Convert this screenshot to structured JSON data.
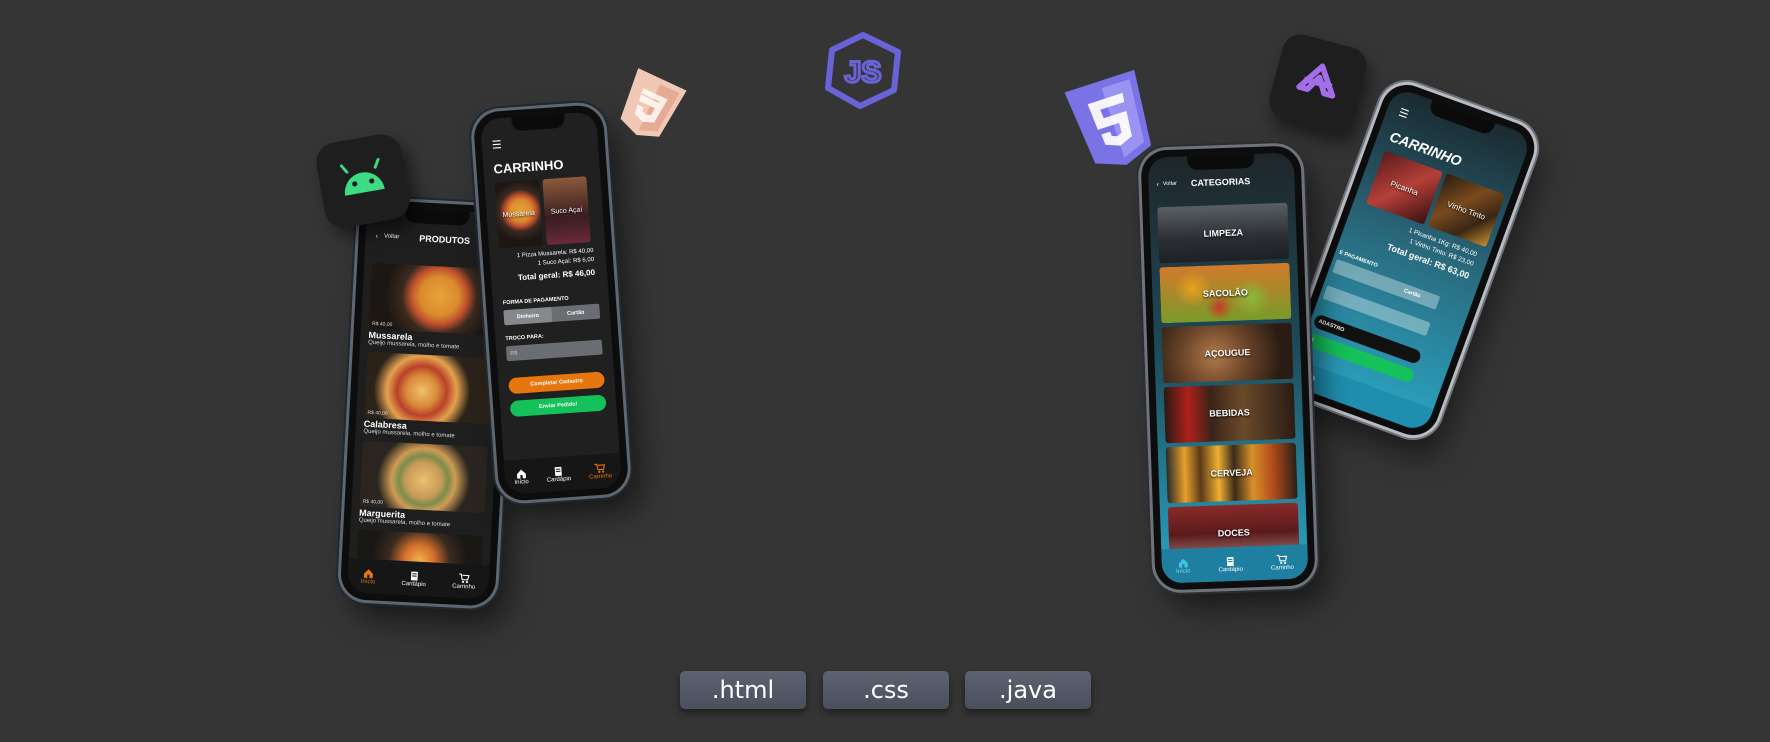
{
  "colors": {
    "background": "#353535",
    "android_green": "#3ddc84",
    "orange": "#e8760e",
    "green": "#14c15a",
    "teal": "#2aa5c4",
    "purple": "#8b7df0"
  },
  "logos": {
    "android": "android-icon",
    "js": "js-icon",
    "css": "css3-icon",
    "html5": "html5-icon",
    "visual_studio": "visual-studio-icon"
  },
  "phone_produtos": {
    "back": "Voltar",
    "title": "PRODUTOS",
    "products": [
      {
        "name": "Mussarela",
        "desc": "Queijo mussarela, molho e tomate",
        "price": "R$ 40,00"
      },
      {
        "name": "Calabresa",
        "desc": "Queijo mussarela, molho e tomate",
        "price": "R$ 40,00"
      },
      {
        "name": "Marguerita",
        "desc": "Queijo mussarela, molho e tomate",
        "price": "R$ 40,00"
      }
    ],
    "tabs": [
      "Início",
      "Cardápio",
      "Carrinho"
    ]
  },
  "phone_carrinho_dark": {
    "title": "CARRINHO",
    "items": [
      "Mussarela",
      "Suco Açaí"
    ],
    "line1": "1 Pizza Mussarela: R$ 40,00",
    "line2": "1 Suco Açaí: R$ 6,00",
    "total": "Total geral: R$ 46,00",
    "payment_label": "FORMA DE PAGAMENTO",
    "pay_cash": "Dinheiro",
    "pay_card": "Cartão",
    "change_label": "TROCO PARA:",
    "change_placeholder": "R$",
    "complete_btn": "Completar Cadastro",
    "send_btn": "Enviar Pedido!",
    "tabs": [
      "Início",
      "Cardápio",
      "Carrinho"
    ]
  },
  "phone_categorias": {
    "back": "Voltar",
    "title": "CATEGORIAS",
    "categories": [
      "LIMPEZA",
      "SACOLÃO",
      "AÇOUGUE",
      "BEBIDAS",
      "CERVEJA",
      "DOCES"
    ],
    "tabs": [
      "Início",
      "Cardápio",
      "Carrinho"
    ]
  },
  "phone_carrinho_teal": {
    "title": "CARRINHO",
    "items": [
      "Picanha",
      "Vinho Tinto"
    ],
    "line1": "1 Picanha 1Kg: R$ 40,00",
    "line2": "1 Vinho Tinto: R$ 23,00",
    "total": "Total geral: R$ 63,00",
    "payment_label": "E PAGAMENTO",
    "pay_card": "Cartão",
    "complete_btn": "ADASTRO",
    "send_btn": "!"
  },
  "extensions": [
    ".html",
    ".css",
    ".java"
  ]
}
